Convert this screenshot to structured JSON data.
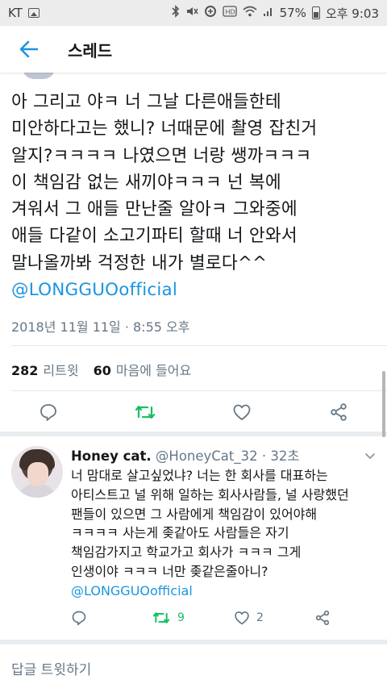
{
  "status_bar": {
    "carrier": "KT",
    "battery": "57%",
    "time": "오후 9:03",
    "icons": [
      "gallery-icon",
      "bluetooth-icon",
      "mute-icon",
      "data-saver-icon",
      "hd-icon",
      "wifi-icon",
      "signal-icon",
      "battery-icon"
    ]
  },
  "header": {
    "title": "스레드",
    "back_icon": "arrow-left-icon"
  },
  "tweet": {
    "text": "아 그리고 야ㅋ 너 그날 다른애들한테\n미안하다고는 했니? 너때문에 촬영 잡친거\n알지?ㅋㅋㅋㅋ 나였으면 너랑 쌩까ㅋㅋㅋ\n이 책임감 없는 새끼야ㅋㅋㅋ 넌 복에\n겨워서 그 애들 만난줄 알아ㅋ 그와중에\n애들 다같이 소고기파티 할때 너 안와서\n말나올까봐 걱정한 내가 별로다^^",
    "mention": "@LONGGUOofficial",
    "timestamp": "2018년 11월 11일 · 8:55 오후",
    "retweets_count": "282",
    "retweets_label": "리트윗",
    "likes_count": "60",
    "likes_label": "마음에 들어요"
  },
  "reply": {
    "name": "Honey cat.",
    "handle": "@HoneyCat_32",
    "time_ago": "· 32초",
    "text": "너 맘대로 살고싶었냐? 너는 한 회사를 대표하는\n아티스트고 널 위해 일하는 회사사람들, 널 사랑했던\n팬들이 있으면 그 사람에게 책임감이 있어야해\nㅋㅋㅋㅋ 사는게 좆같아도 사람들은 자기\n책임감가지고 학교가고 회사가 ㅋㅋㅋ 그게\n인생이야 ㅋㅋㅋ 너만 좆같은줄아니?",
    "mention": "@LONGGUOofficial",
    "retweet_count": "9",
    "like_count": "2"
  },
  "compose": {
    "placeholder": "답글 트윗하기"
  },
  "colors": {
    "accent": "#1b95e0",
    "retweet_green": "#17bf63",
    "secondary_text": "#657786",
    "icon_gray": "#657786"
  }
}
